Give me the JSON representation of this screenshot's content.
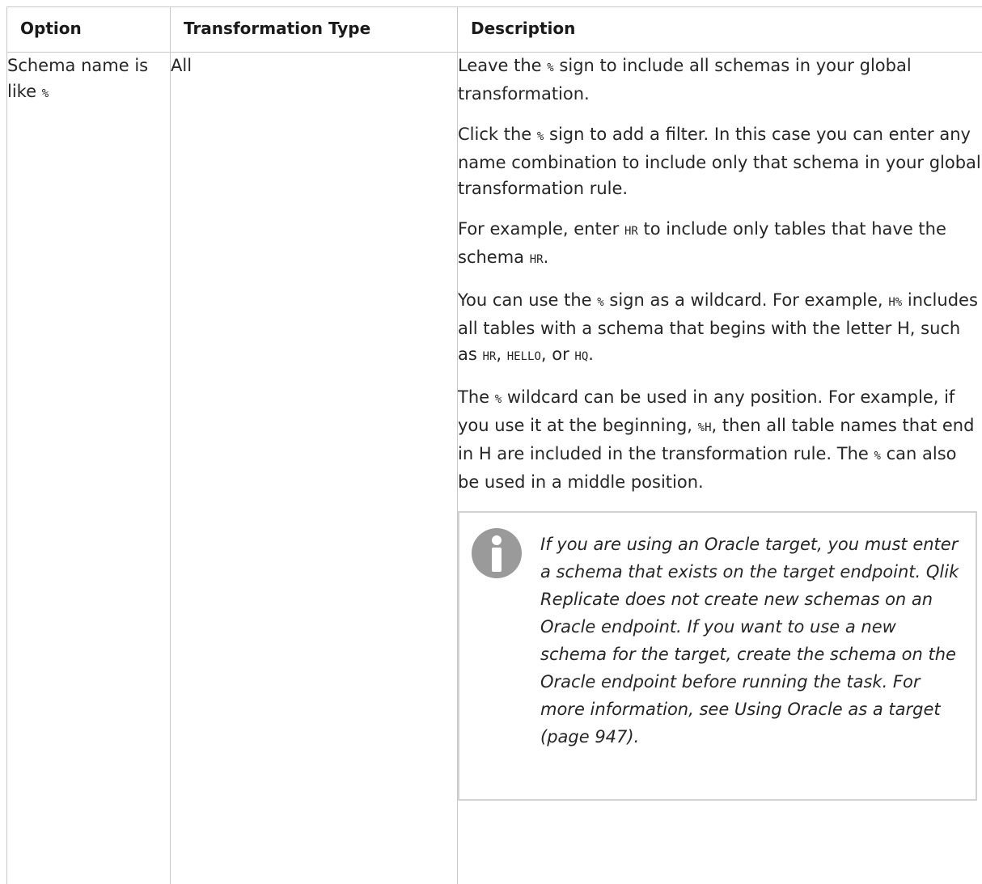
{
  "table": {
    "headers": [
      "Option",
      "Transformation Type",
      "Description"
    ],
    "row": {
      "option_text": "Schema name is like",
      "option_code": "%",
      "type": "All",
      "description": {
        "p1": {
          "a": "Leave the",
          "code": "%",
          "b": "sign to include all schemas in your global transformation."
        },
        "p2": {
          "a": "Click the",
          "code": "%",
          "b": "sign to add a filter. In this case you can enter any name combination to include only that schema in your global transformation rule."
        },
        "p3": {
          "a": "For example, enter",
          "code1": "HR",
          "b": "to include only tables that have the schema",
          "code2": "HR",
          "c": "."
        },
        "p4": {
          "a": "You can use the",
          "code1": "%",
          "b": "sign as a wildcard. For example,",
          "code2": "H%",
          "c": "includes all tables with a schema that begins with the letter H, such as",
          "code3": "HR",
          "d": ",",
          "code4": "HELLO",
          "e": ", or",
          "code5": "HQ",
          "f": "."
        },
        "p5": {
          "a": "The",
          "code1": "%",
          "b": "wildcard can be used in any position. For example, if you use it at the beginning,",
          "code2": "%H",
          "c": ", then all table names that end in H are included in the transformation rule. The",
          "code3": "%",
          "d": "can also be used in a middle position."
        },
        "note": {
          "icon": "info-icon",
          "text": "If you are using an Oracle target, you must enter a schema that exists on the target endpoint. Qlik Replicate does not create new schemas on an Oracle endpoint. If you want to use a new schema for the target, create the schema on the Oracle endpoint before running the task. For more information, see Using Oracle as a target (page 947)."
        }
      }
    }
  },
  "colors": {
    "border": "#c8c8c8",
    "text": "#262626",
    "icon": "#9a9a9a"
  }
}
